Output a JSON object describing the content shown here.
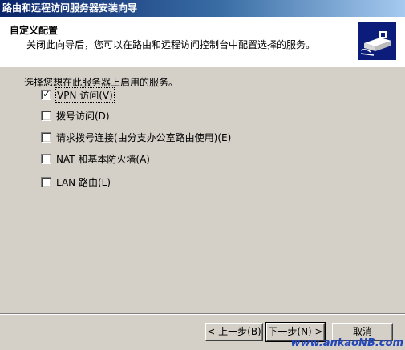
{
  "window": {
    "title": "路由和远程访问服务器安装向导"
  },
  "header": {
    "title": "自定义配置",
    "subtitle": "关闭此向导后，您可以在路由和远程访问控制台中配置选择的服务。",
    "icon": "network-server-icon"
  },
  "content": {
    "prompt": "选择您想在此服务器上启用的服务。",
    "options": [
      {
        "label": "VPN 访问(V)",
        "checked": true
      },
      {
        "label": "拨号访问(D)",
        "checked": false
      },
      {
        "label": "请求拨号连接(由分支办公室路由使用)(E)",
        "checked": false
      },
      {
        "label": "NAT 和基本防火墙(A)",
        "checked": false
      },
      {
        "label": "LAN 路由(L)",
        "checked": false
      }
    ]
  },
  "buttons": {
    "back": "< 上一步(B)",
    "next": "下一步(N) >",
    "cancel": "取消"
  },
  "watermark": "www.ankaoNB.com",
  "colors": {
    "title_bar": "#0a246a",
    "header_icon_bg": "#0b1c7a",
    "face": "#d4d0c8"
  }
}
